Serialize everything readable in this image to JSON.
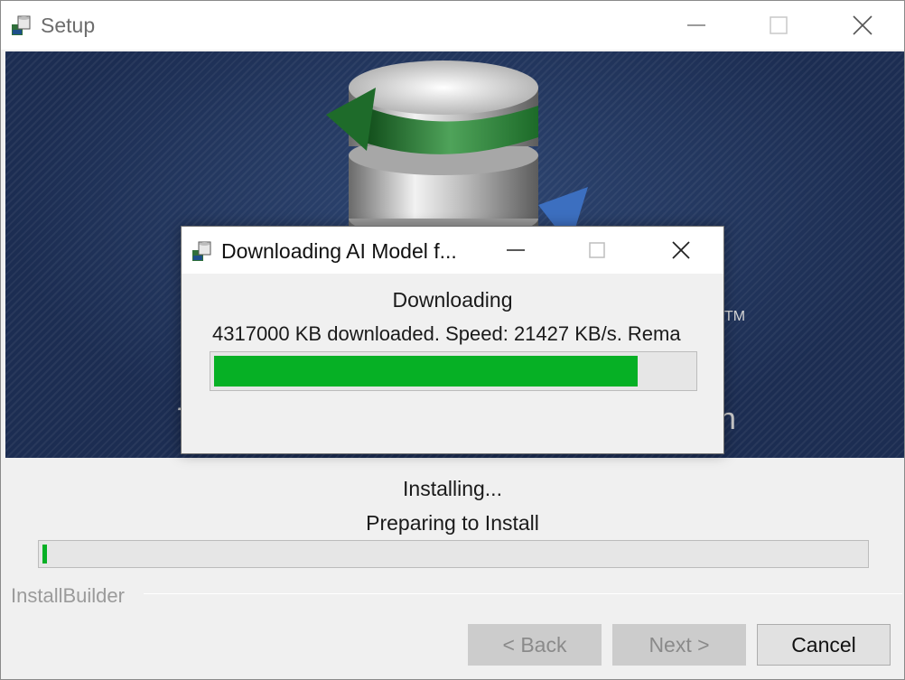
{
  "window": {
    "title": "Setup",
    "controls": [
      "minimize",
      "maximize",
      "close"
    ]
  },
  "banner": {
    "tm": "TM"
  },
  "status": {
    "line1": "Installing...",
    "line2": "Preparing to Install",
    "progress_fraction": 0.005
  },
  "branding": {
    "label": "InstallBuilder"
  },
  "buttons": {
    "back": "< Back",
    "next": "Next >",
    "cancel": "Cancel"
  },
  "dialog": {
    "title": "Downloading AI Model f...",
    "heading": "Downloading",
    "detail": "4317000 KB downloaded. Speed: 21427 KB/s. Rema",
    "progress_fraction": 0.885
  },
  "colors": {
    "progress": "#06b025",
    "banner_bg": "#1f3258",
    "disabled_text": "#8a8a8a"
  }
}
